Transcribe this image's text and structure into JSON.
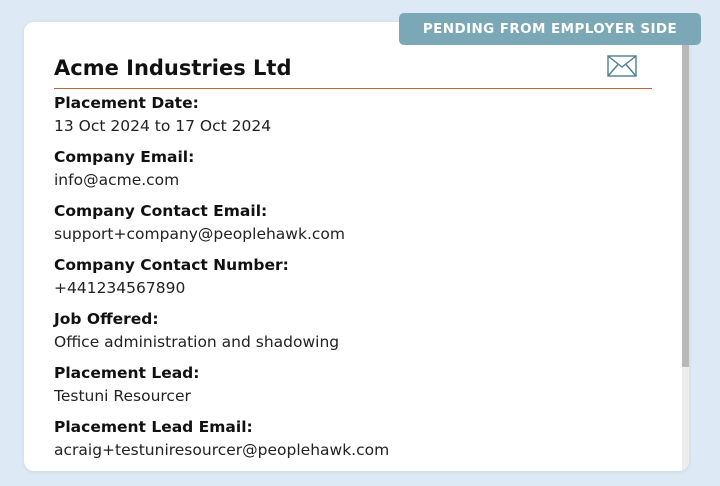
{
  "status_badge": "PENDING FROM EMPLOYER SIDE",
  "company_name": "Acme Industries Ltd",
  "fields": [
    {
      "label": "Placement Date:",
      "value": "13 Oct 2024 to 17 Oct 2024"
    },
    {
      "label": "Company Email:",
      "value": "info@acme.com"
    },
    {
      "label": "Company Contact Email:",
      "value": "support+company@peoplehawk.com"
    },
    {
      "label": "Company Contact Number:",
      "value": "+441234567890"
    },
    {
      "label": "Job Offered:",
      "value": "Office administration and shadowing"
    },
    {
      "label": "Placement Lead:",
      "value": "Testuni Resourcer"
    },
    {
      "label": "Placement Lead Email:",
      "value": "acraig+testuniresourcer@peoplehawk.com"
    }
  ],
  "icons": {
    "mail": "envelope-icon"
  },
  "colors": {
    "badge_bg": "#7aa8b6",
    "title_rule": "#c2613c",
    "page_bg": "#dde9f5"
  }
}
